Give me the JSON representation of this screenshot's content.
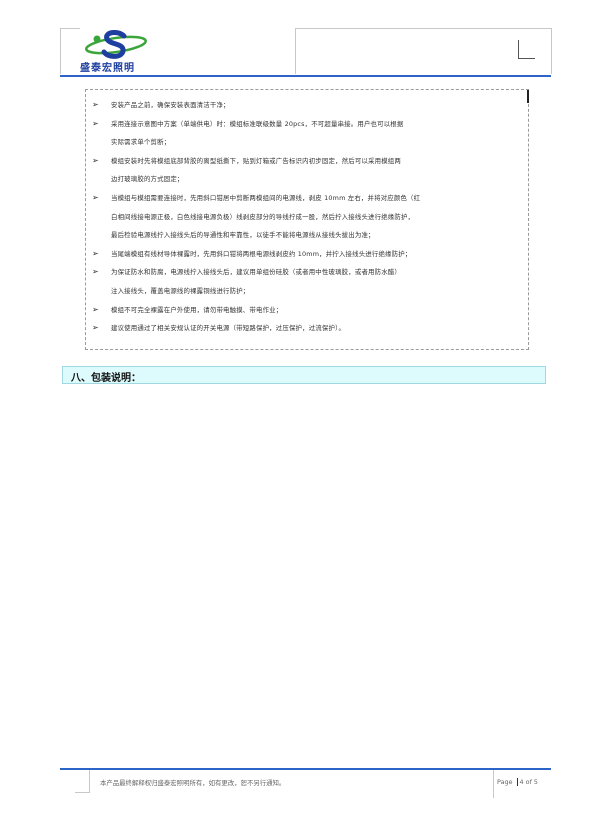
{
  "header": {
    "company_name": "盛泰宏照明"
  },
  "instructions": [
    {
      "lines": [
        "安装产品之前，确保安装表面清洁干净；"
      ]
    },
    {
      "lines": [
        "采用连接示意图中方案（单端供电）时：模组标准联级数量 20pcs，不可超量串接。用户也可以根据",
        "实际需求单个剪断；"
      ]
    },
    {
      "lines": [
        "模组安装时先将模组底部背胶的离型纸撕下，贴到灯箱或广告标识内初步固定，然后可以采用模组两",
        "边打玻璃胶的方式固定；"
      ]
    },
    {
      "lines": [
        "当模组与模组需要连接时，先用斜口钳居中剪断两模组间的电源线，剥皮 10mm 左右，并将对应颜色（红",
        "白相间线接电源正极，白色线接电源负极）线剥皮部分的导线拧成一股，然后拧入接线头进行绝缘防护，",
        "最后检验电源线拧入接线头后的导通性和牢靠性，以徒手不能将电源线从接线头拔出为准；"
      ]
    },
    {
      "lines": [
        "当尾端模组有线材导体裸露时，先用斜口钳将两根电源线剥皮约 10mm，并拧入接线头进行绝缘防护；"
      ]
    },
    {
      "lines": [
        "为保证防水和防腐，电源线拧入接线头后，建议用单组份硅胶（或者用中性玻璃胶，或者用防水醋）",
        "注入接线头，覆盖电源线的裸露铜线进行防护；"
      ]
    },
    {
      "lines": [
        "模组不可完全裸露在户外使用，请勿带电触摸、带电作业；"
      ]
    },
    {
      "lines": [
        "建议使用通过了相关安规认证的开关电源（带短路保护，过压保护，过流保护）。"
      ]
    }
  ],
  "section": {
    "title": "八、包装说明："
  },
  "footer": {
    "notice": "本产品最终解释权归盛泰宏照明所有，如有更改，恕不另行通知。",
    "page_label": "Page",
    "page_current": "4",
    "page_of": "of",
    "page_total": "5"
  },
  "colors": {
    "rule_blue": "#2d64c8",
    "logo_green": "#3aa53a",
    "logo_blue": "#1e3fa0",
    "section_bg": "#ddfbfd"
  }
}
